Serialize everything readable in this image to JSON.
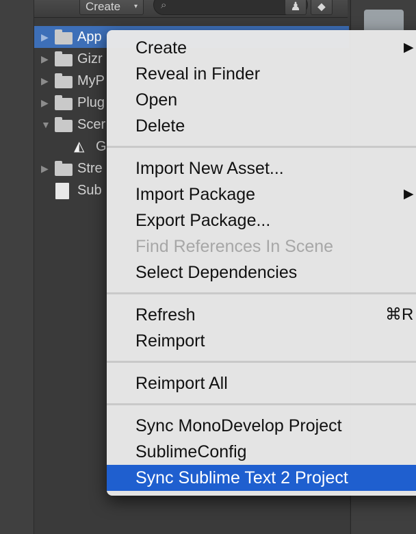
{
  "toolbar": {
    "create_label": "Create",
    "create_arrow": "▾",
    "search_icon": "search-icon",
    "filter_icons": [
      "person-filter-icon",
      "tag-icon"
    ]
  },
  "tree": {
    "items": [
      {
        "label": "App",
        "kind": "folder",
        "expanded": false,
        "selected": true
      },
      {
        "label": "Gizr",
        "kind": "folder",
        "expanded": false,
        "selected": false
      },
      {
        "label": "MyP",
        "kind": "folder",
        "expanded": false,
        "selected": false
      },
      {
        "label": "Plug",
        "kind": "folder",
        "expanded": false,
        "selected": false
      },
      {
        "label": "Scer",
        "kind": "folder",
        "expanded": true,
        "selected": false
      },
      {
        "label": "G",
        "kind": "unity-scene",
        "expanded": false,
        "selected": false
      },
      {
        "label": "Stre",
        "kind": "folder",
        "expanded": false,
        "selected": false
      },
      {
        "label": "Sub",
        "kind": "file",
        "expanded": false,
        "selected": false
      }
    ]
  },
  "context_menu": {
    "group1": {
      "create": "Create",
      "reveal_in_finder": "Reveal in Finder",
      "open": "Open",
      "delete": "Delete"
    },
    "group2": {
      "import_new_asset": "Import New Asset...",
      "import_package": "Import Package",
      "export_package": "Export Package...",
      "find_references": "Find References In Scene",
      "select_dependencies": "Select Dependencies"
    },
    "group3": {
      "refresh": "Refresh",
      "refresh_shortcut": "⌘R",
      "reimport": "Reimport"
    },
    "group4": {
      "reimport_all": "Reimport All"
    },
    "group5": {
      "sync_monodevelop": "Sync MonoDevelop Project",
      "sublime_config": "SublimeConfig",
      "sync_sublime": "Sync Sublime Text 2 Project"
    },
    "submenu_arrow": "▶",
    "highlighted_item": "Sync Sublime Text 2 Project",
    "disabled_items": [
      "Find References In Scene"
    ]
  },
  "colors": {
    "selection_blue": "#3d6fb8",
    "menu_highlight": "#1f5fcf",
    "menu_background": "#e8e8e8",
    "panel_dark": "#3a3a3a"
  }
}
